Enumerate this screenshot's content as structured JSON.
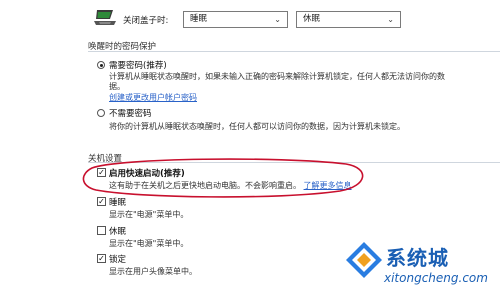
{
  "lid": {
    "label": "关闭盖子时:",
    "on_battery": "睡眠",
    "plugged_in": "休眠"
  },
  "password_section": {
    "title": "唤醒时的密码保护",
    "option_require": {
      "title": "需要密码(推荐)",
      "desc_line1": "计算机从睡眠状态唤醒时，如果未输入正确的密码来解除计算机锁定，任何人都无法访问你的数",
      "desc_line2": "据。",
      "link": "创建或更改用户帐户密码"
    },
    "option_no": {
      "title": "不需要密码",
      "desc": "将你的计算机从睡眠状态唤醒时，任何人都可以访问你的数据，因为计算机未锁定。"
    }
  },
  "shutdown_section": {
    "title": "关机设置",
    "fast_startup": {
      "title": "启用快速启动(推荐)",
      "desc": "这有助于在关机之后更快地启动电脑。不会影响重启。",
      "link": "了解更多信息"
    },
    "sleep": {
      "title": "睡眠",
      "desc": "显示在\"电源\"菜单中。"
    },
    "hibernate": {
      "title": "休眠",
      "desc": "显示在\"电源\"菜单中。"
    },
    "lock": {
      "title": "锁定",
      "desc": "显示在用户头像菜单中。"
    }
  },
  "watermark": {
    "name": "系统城",
    "url": "xitongcheng.com"
  },
  "colors": {
    "annotation_red": "#c8102e",
    "link_blue": "#2962c8",
    "watermark_blue": "#1a5fb4"
  }
}
